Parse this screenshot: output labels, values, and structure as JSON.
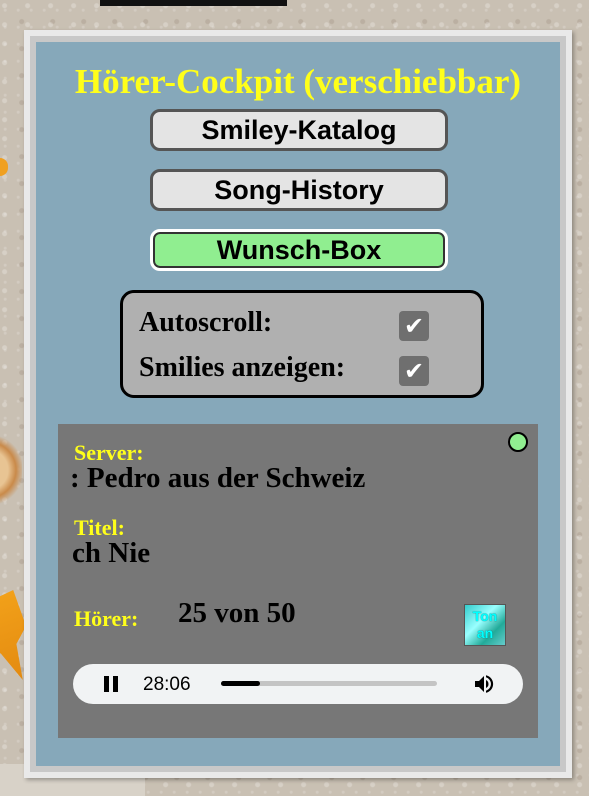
{
  "cockpit": {
    "title": "Hörer-Cockpit (verschiebbar)",
    "buttons": {
      "smiley": "Smiley-Katalog",
      "history": "Song-History",
      "wunsch": "Wunsch-Box"
    },
    "options": {
      "autoscroll_label": "Autoscroll:",
      "autoscroll_checked": true,
      "smilies_label": "Smilies anzeigen:",
      "smilies_checked": true,
      "check_glyph": "✔"
    }
  },
  "player": {
    "server_label": "Server:",
    "server_value": ": Pedro aus der Schweiz",
    "title_label": "Titel:",
    "title_value": "ch Nie",
    "listeners_label": "Hörer:",
    "listeners_value": "25 von 50",
    "ton_line1": "Ton",
    "ton_line2": "an",
    "status_color": "#90ee90"
  },
  "audio": {
    "time": "28:06",
    "progress": 0.18,
    "state": "playing"
  },
  "colors": {
    "panel_bg": "#86a8ba",
    "title": "#ffff1a",
    "wunsch_bg": "#90ee90"
  }
}
